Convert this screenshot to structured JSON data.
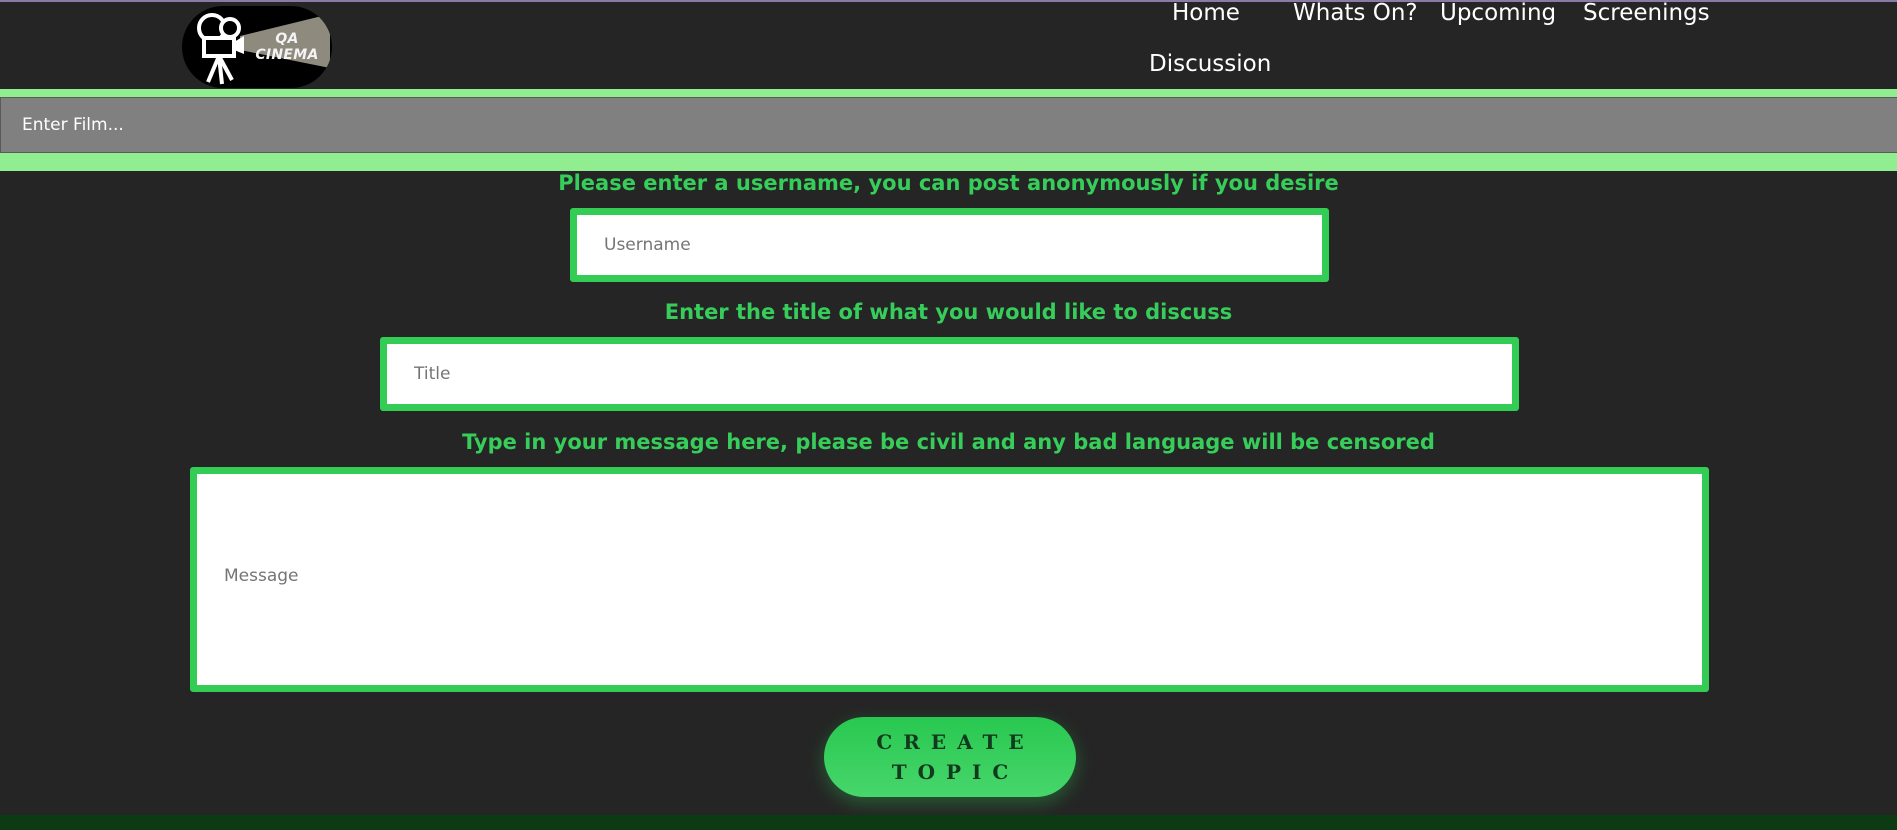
{
  "header": {
    "logo_text": "QA CINEMA",
    "nav": [
      {
        "label": "Home"
      },
      {
        "label": "Whats On?"
      },
      {
        "label": "Upcoming"
      },
      {
        "label": "Screenings"
      },
      {
        "label": "Discussion"
      }
    ]
  },
  "search": {
    "placeholder": "Enter Film..."
  },
  "form": {
    "username_label": "Please enter a username, you can post anonymously if you desire",
    "username_placeholder": "Username",
    "title_label": "Enter the title of what you would like to discuss",
    "title_placeholder": "Title",
    "message_label": "Type in your message here, please be civil and any bad language will be censored",
    "message_placeholder": "Message",
    "submit_line1": "CREATE",
    "submit_line2": "TOPIC"
  },
  "colors": {
    "background": "#252525",
    "accent_green": "#33cc55",
    "search_band": "#90ee90",
    "search_input": "#808080"
  }
}
